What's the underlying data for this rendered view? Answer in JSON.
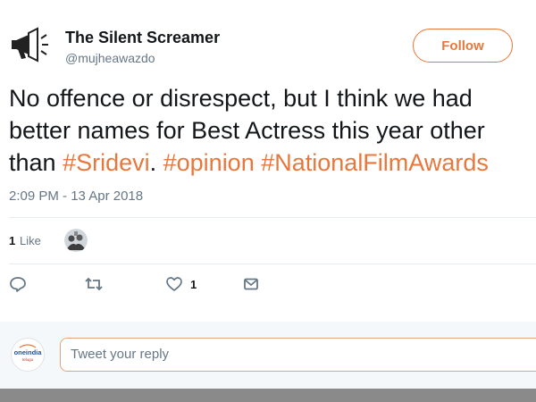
{
  "user": {
    "display_name": "The Silent Screamer",
    "handle": "@mujheawazdo",
    "avatar_icon": "megaphone-icon"
  },
  "follow_button": {
    "label": "Follow"
  },
  "tweet": {
    "line1": "No offence or disrespect, but I think we had",
    "line2": "better names for Best Actress this year other",
    "line3_prefix": "than ",
    "hashtags": [
      "#Sridevi",
      "#opinion",
      "#NationalFilmAwards"
    ],
    "hashtag_sep1": ". ",
    "hashtag_sep2": " ",
    "timestamp": "2:09 PM - 13 Apr 2018"
  },
  "engagement": {
    "likes_count": "1",
    "likes_label": "Like"
  },
  "actions": {
    "reply_icon": "reply-icon",
    "retweet_icon": "retweet-icon",
    "like_icon": "heart-icon",
    "like_count": "1",
    "dm_icon": "mail-icon"
  },
  "reply_box": {
    "placeholder": "Tweet your reply",
    "avatar_text": "oneindia",
    "avatar_subtext": "telugu"
  },
  "colors": {
    "accent": "#e8773c",
    "text": "#14171a",
    "muted": "#657786"
  }
}
